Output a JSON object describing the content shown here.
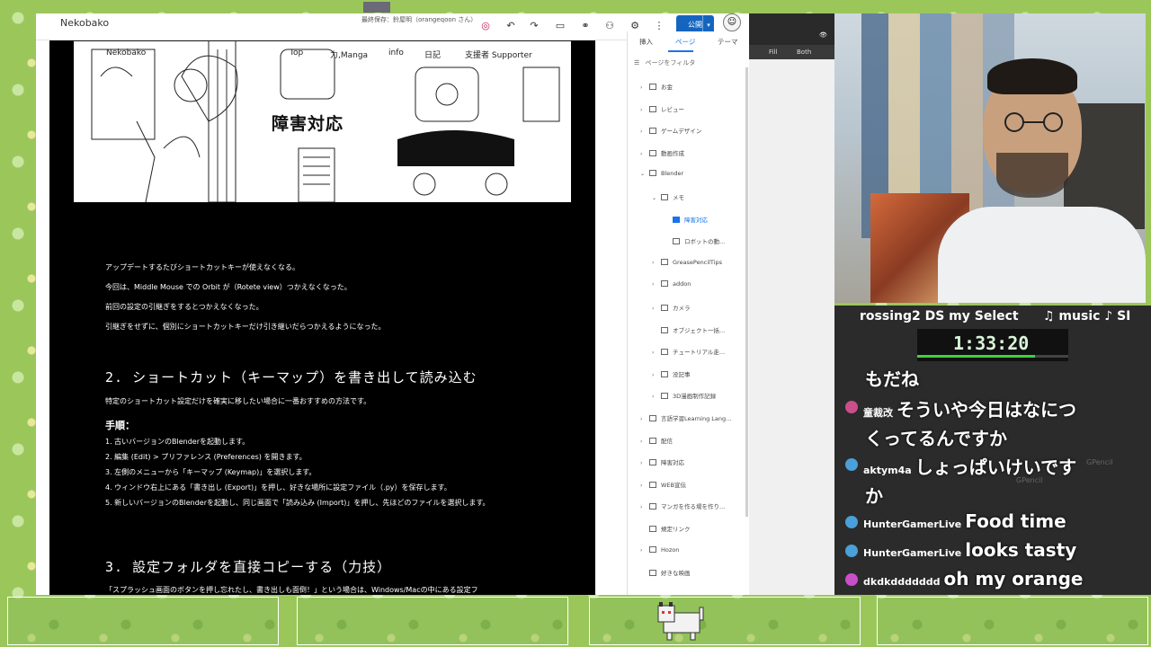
{
  "editor": {
    "site_name": "Nekobako",
    "save_status": "最終保存：鈴屋明（orangeqoon さん）",
    "publish_label": "公開"
  },
  "page": {
    "nav_logo": "Nekobako",
    "nav_items": [
      "Top",
      "力,Manga",
      "info",
      "日記",
      "支援者 Supporter"
    ],
    "banner_title": "障害対応",
    "paragraphs": [
      "アップデートするたびショートカットキーが使えなくなる。",
      "今回は、Middle Mouse での Orbit が（Rotete view）つかえなくなった。",
      "前回の設定の引継ぎをするとつかえなくなった。",
      "引継ぎをせずに、個別にショートカットキーだけ引き継いだらつかえるようになった。"
    ],
    "section2_heading": "2. ショートカット（キーマップ）を書き出して読み込む",
    "section2_intro": "特定のショートカット設定だけを確実に移したい場合に一番おすすめの方法です。",
    "steps_heading": "手順：",
    "steps": [
      "1. 古いバージョンのBlenderを起動します。",
      "2. 編集 (Edit) > プリファレンス (Preferences) を開きます。",
      "3. 左側のメニューから「キーマップ (Keymap)」を選択します。",
      "4. ウィンドウ右上にある「書き出し (Export)」を押し、好きな場所に設定ファイル（.py）を保存します。",
      "5. 新しいバージョンのBlenderを起動し、同じ画面で「読み込み (Import)」を押し、先ほどのファイルを選択します。"
    ],
    "section3_heading": "3. 設定フォルダを直接コピーする（力技）",
    "section3_intro": "「スプラッシュ画面のボタンを押し忘れたし、書き出しも面倒！」という場合は、Windows/Macの中にある設定フ"
  },
  "sidebar": {
    "tabs": [
      "挿入",
      "ページ",
      "テーマ"
    ],
    "filter_label": "ページをフィルタ",
    "tree": [
      {
        "label": "お金",
        "indent": 0,
        "chev": "›",
        "active": false
      },
      {
        "label": "レビュー",
        "indent": 0,
        "chev": "›",
        "active": false
      },
      {
        "label": "ゲームデザイン",
        "indent": 0,
        "chev": "›",
        "active": false
      },
      {
        "label": "動画作成",
        "indent": 0,
        "chev": "›",
        "active": false
      },
      {
        "label": "Blender",
        "indent": 0,
        "chev": "⌄",
        "active": false
      },
      {
        "label": "メモ",
        "indent": 1,
        "chev": "⌄",
        "active": false
      },
      {
        "label": "障害対応",
        "indent": 2,
        "chev": "",
        "active": true
      },
      {
        "label": "ロボットの動...",
        "indent": 2,
        "chev": "",
        "active": false
      },
      {
        "label": "GreasePencilTips",
        "indent": 1,
        "chev": "›",
        "active": false
      },
      {
        "label": "addon",
        "indent": 1,
        "chev": "›",
        "active": false
      },
      {
        "label": "カメラ",
        "indent": 1,
        "chev": "›",
        "active": false
      },
      {
        "label": "オブジェクト一括...",
        "indent": 1,
        "chev": "",
        "active": false
      },
      {
        "label": "チュートリアル走...",
        "indent": 1,
        "chev": "›",
        "active": false
      },
      {
        "label": "没記事",
        "indent": 1,
        "chev": "›",
        "active": false
      },
      {
        "label": "3D漫画制作記録",
        "indent": 1,
        "chev": "›",
        "active": false
      },
      {
        "label": "言語学習Learning Lang...",
        "indent": 0,
        "chev": "›",
        "active": false
      },
      {
        "label": "配信",
        "indent": 0,
        "chev": "›",
        "active": false
      },
      {
        "label": "障害対応",
        "indent": 0,
        "chev": "›",
        "active": false
      },
      {
        "label": "WEB宣伝",
        "indent": 0,
        "chev": "›",
        "active": false
      },
      {
        "label": "マンガを作る場を作り...",
        "indent": 0,
        "chev": "›",
        "active": false
      },
      {
        "label": "規定リンク",
        "indent": 0,
        "chev": "",
        "active": false
      },
      {
        "label": "Hozon",
        "indent": 0,
        "chev": "›",
        "active": false
      },
      {
        "label": "好きな映画",
        "indent": 0,
        "chev": "",
        "active": false
      }
    ]
  },
  "blender": {
    "fill_label": "Fill",
    "both_label": "Both"
  },
  "stream": {
    "ticker_left": "rossing2 DS my Select",
    "ticker_right": "♫ music ♪ SI",
    "timer": "1:33:20",
    "timer_progress": 0.78,
    "blender_labels": [
      "GPencil",
      "GPencil"
    ],
    "chat": [
      {
        "author": "",
        "text": "もだね"
      },
      {
        "author": "童裁改",
        "text": "そういや今日はなにつ"
      },
      {
        "author": "",
        "text": "くってるんですか"
      },
      {
        "author": "aktym4a",
        "text": "しょっぱいけいです"
      },
      {
        "author": "",
        "text": "か"
      },
      {
        "author": "HunterGamerLive",
        "text": "Food time"
      },
      {
        "author": "HunterGamerLive",
        "text": "looks tasty"
      },
      {
        "author": "dkdkddddddd",
        "text": "oh my orange"
      }
    ]
  }
}
